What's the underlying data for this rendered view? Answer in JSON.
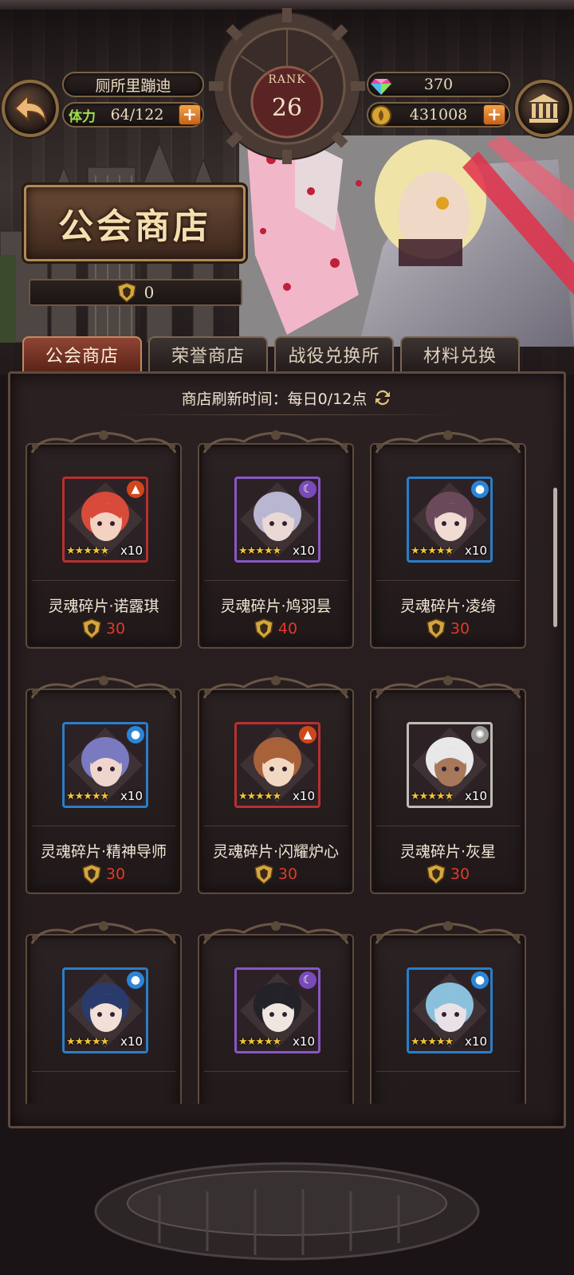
{
  "player": {
    "name": "厕所里蹦迪",
    "stamina_label": "体力",
    "stamina": "64/122",
    "rank_label": "RANK",
    "rank": "26",
    "gems": "370",
    "gold": "431008"
  },
  "banner": {
    "title": "公会商店",
    "token_count": "0"
  },
  "tabs": [
    {
      "label": "公会商店",
      "active": true
    },
    {
      "label": "荣誉商店",
      "active": false
    },
    {
      "label": "战役兑换所",
      "active": false
    },
    {
      "label": "材料兑换",
      "active": false
    }
  ],
  "shop": {
    "refresh_text": "商店刷新时间：每日0/12点",
    "items": [
      {
        "name": "灵魂碎片·诺露琪",
        "price": "30",
        "qty": "x10",
        "element": "fire"
      },
      {
        "name": "灵魂碎片·鸠羽昙",
        "price": "40",
        "qty": "x10",
        "element": "dark"
      },
      {
        "name": "灵魂碎片·凌绮",
        "price": "30",
        "qty": "x10",
        "element": "water"
      },
      {
        "name": "灵魂碎片·精神导师",
        "price": "30",
        "qty": "x10",
        "element": "water"
      },
      {
        "name": "灵魂碎片·闪耀炉心",
        "price": "30",
        "qty": "x10",
        "element": "fire"
      },
      {
        "name": "灵魂碎片·灰星",
        "price": "30",
        "qty": "x10",
        "element": "light"
      },
      {
        "name": "",
        "price": "",
        "qty": "x10",
        "element": "water"
      },
      {
        "name": "",
        "price": "",
        "qty": "x10",
        "element": "dark"
      },
      {
        "name": "",
        "price": "",
        "qty": "x10",
        "element": "water"
      }
    ]
  },
  "colors": {
    "accent_gold": "#b08b58",
    "price_red": "#e03a2a",
    "active_tab": "#8f4434",
    "fire": "#b83030",
    "water": "#2a7ec8",
    "dark": "#8a56c6",
    "light": "#bfbcb6"
  }
}
